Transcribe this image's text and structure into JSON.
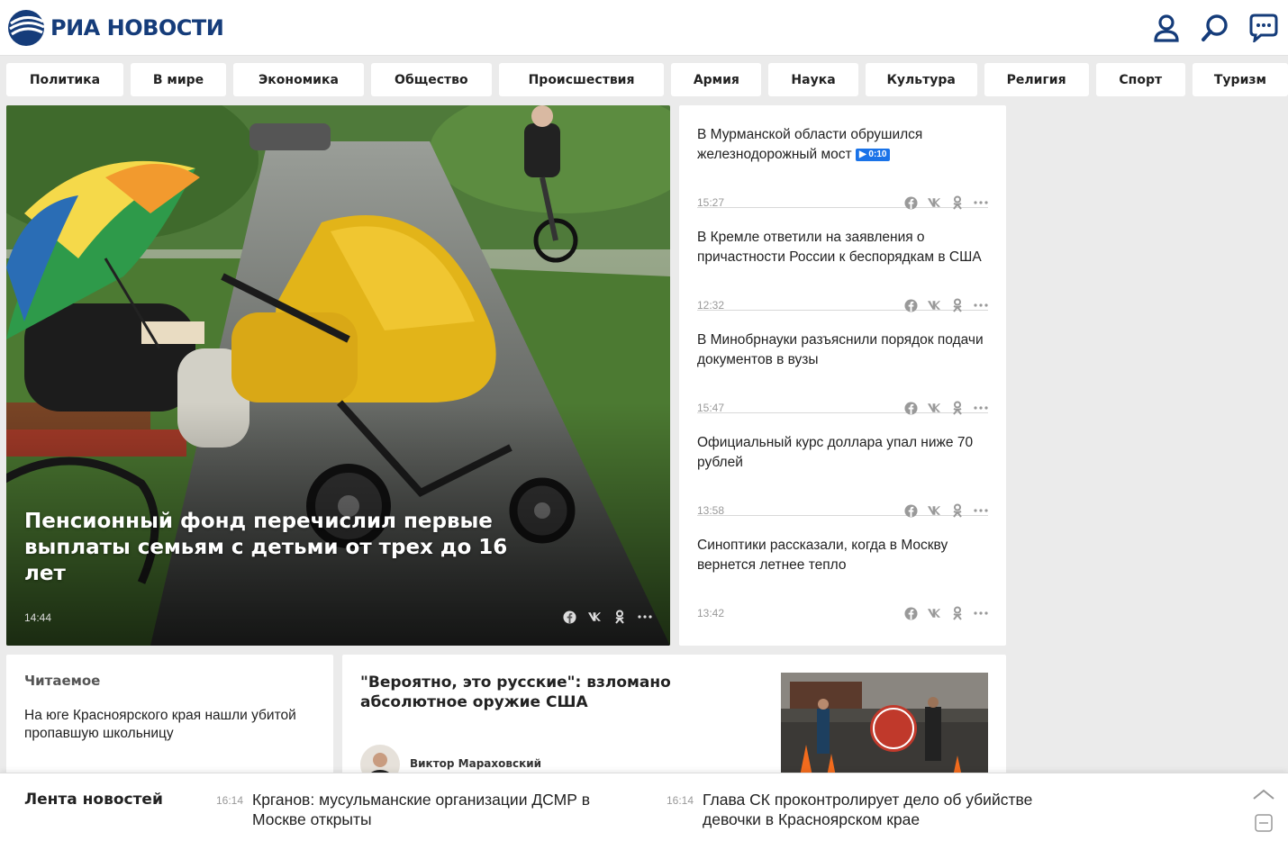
{
  "header": {
    "logo_text": "РИА НОВОСТИ",
    "icons": [
      "user-icon",
      "search-icon",
      "chat-icon"
    ]
  },
  "nav": {
    "items": [
      "Политика",
      "В мире",
      "Экономика",
      "Общество",
      "Происшествия",
      "Армия",
      "Наука",
      "Культура",
      "Религия",
      "Спорт",
      "Туризм"
    ]
  },
  "hero": {
    "title": "Пенсионный фонд перечислил первые выплаты семьям с детьми от трех до 16 лет",
    "time": "14:44"
  },
  "news": [
    {
      "title": "В Мурманской области обрушился железнодорожный мост",
      "badge": "▶ 0:10",
      "time": "15:27"
    },
    {
      "title": "В Кремле ответили на заявления о причастности России к беспорядкам в США",
      "time": "12:32"
    },
    {
      "title": "В Минобрнауки разъяснили порядок подачи документов в вузы",
      "time": "15:47"
    },
    {
      "title": "Официальный курс доллара упал ниже 70 рублей",
      "time": "13:58"
    },
    {
      "title": "Синоптики рассказали, когда в Москву вернется летнее тепло",
      "time": "13:42"
    }
  ],
  "read": {
    "heading": "Читаемое",
    "text": "На юге Красноярского края нашли убитой пропавшую школьницу"
  },
  "opinion": {
    "title": "\"Вероятно, это русские\": взломано абсолютное оружие США",
    "author": "Виктор Мараховский"
  },
  "ticker": {
    "label": "Лента новостей",
    "items": [
      {
        "time": "16:14",
        "text": "Крганов: мусульманские организации ДСМР в Москве открыты"
      },
      {
        "time": "16:14",
        "text": "Глава СК проконтролирует дело об убийстве девочки в Красноярском крае"
      }
    ]
  },
  "colors": {
    "brand": "#153c7a",
    "background": "#ebebeb",
    "badge": "#1a73e8"
  }
}
